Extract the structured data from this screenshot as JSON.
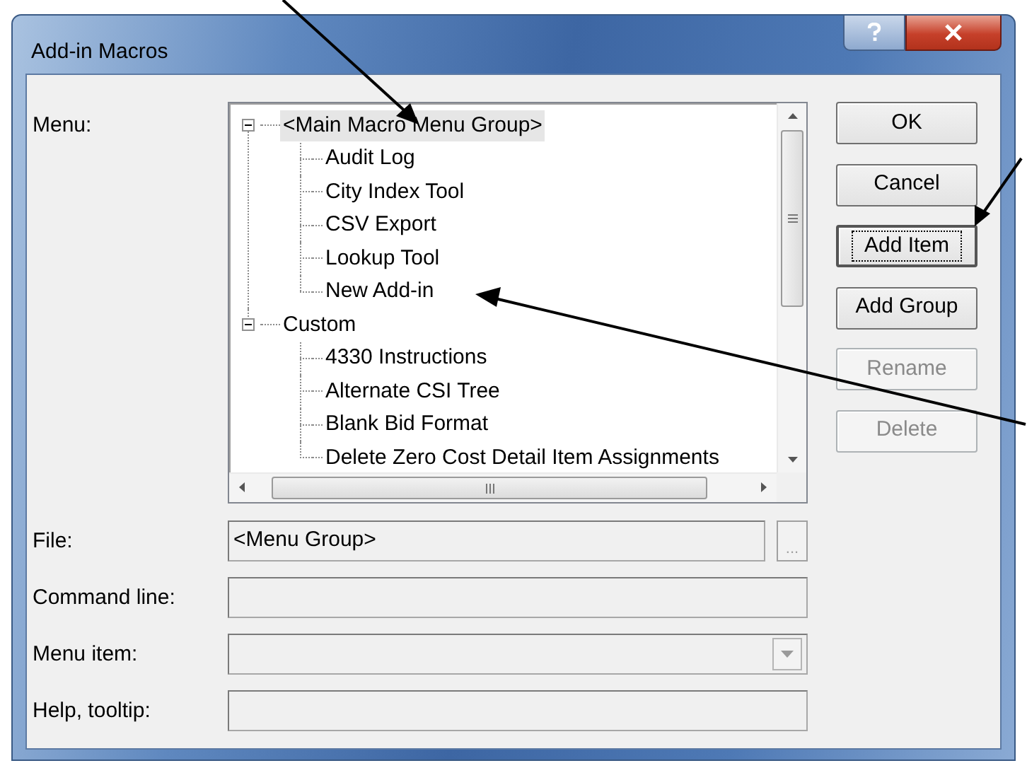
{
  "window": {
    "title": "Add-in Macros"
  },
  "menu": {
    "label": "Menu:",
    "tree": [
      {
        "label": "<Main Macro Menu Group>",
        "selected": true,
        "expanded": true,
        "children": [
          {
            "label": "Audit Log",
            "selected": false
          },
          {
            "label": "City Index Tool",
            "selected": false
          },
          {
            "label": "CSV Export",
            "selected": false
          },
          {
            "label": "Lookup Tool",
            "selected": false
          },
          {
            "label": "New Add-in",
            "selected": false
          }
        ]
      },
      {
        "label": "Custom",
        "selected": false,
        "expanded": true,
        "children": [
          {
            "label": "4330 Instructions",
            "selected": false
          },
          {
            "label": "Alternate CSI Tree",
            "selected": false
          },
          {
            "label": "Blank Bid Format",
            "selected": false
          },
          {
            "label": "Delete Zero Cost Detail Item Assignments",
            "selected": false
          }
        ]
      }
    ]
  },
  "buttons": [
    {
      "label": "OK",
      "disabled": false,
      "focused": false
    },
    {
      "label": "Cancel",
      "disabled": false,
      "focused": false
    },
    {
      "label": "Add Item",
      "disabled": false,
      "focused": true
    },
    {
      "label": "Add Group",
      "disabled": false,
      "focused": false
    },
    {
      "label": "Rename",
      "disabled": true,
      "focused": false
    },
    {
      "label": "Delete",
      "disabled": true,
      "focused": false
    }
  ],
  "fields": [
    {
      "label": "File:",
      "kind": "text",
      "value": "<Menu Group>",
      "browse_label": "...",
      "disabled": true
    },
    {
      "label": "Command line:",
      "kind": "text",
      "disabled": true
    },
    {
      "label": "Menu item:",
      "kind": "combo",
      "disabled": true
    },
    {
      "label": "Help, tooltip:",
      "kind": "text",
      "disabled": true
    }
  ]
}
